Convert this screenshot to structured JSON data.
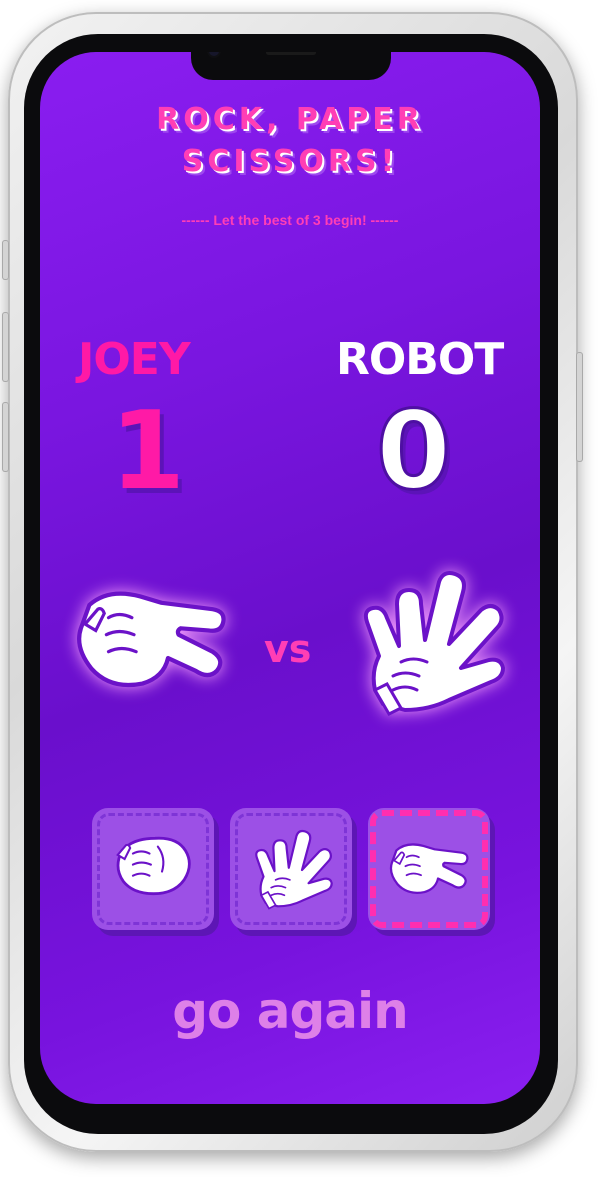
{
  "app": {
    "title_line1": "ROCK, PAPER",
    "title_line2": "SCISSORS!",
    "subtitle": "------ Let the best of 3 begin! ------"
  },
  "players": {
    "player": {
      "name": "JOEY",
      "score": "1",
      "hand": "scissors-hand-icon"
    },
    "opponent": {
      "name": "ROBOT",
      "score": "0",
      "hand": "paper-hand-icon"
    }
  },
  "vs_label": "vs",
  "choices": [
    {
      "id": "rock",
      "icon": "rock-hand-icon",
      "selected": false
    },
    {
      "id": "paper",
      "icon": "paper-hand-icon",
      "selected": false
    },
    {
      "id": "scissors",
      "icon": "scissors-hand-icon",
      "selected": true
    }
  ],
  "go_again_label": "go again",
  "colors": {
    "accent_pink": "#ff19a6",
    "background_purple": "#7a16e0",
    "tile_purple": "#9c50e6",
    "go_again": "#de80e8"
  }
}
